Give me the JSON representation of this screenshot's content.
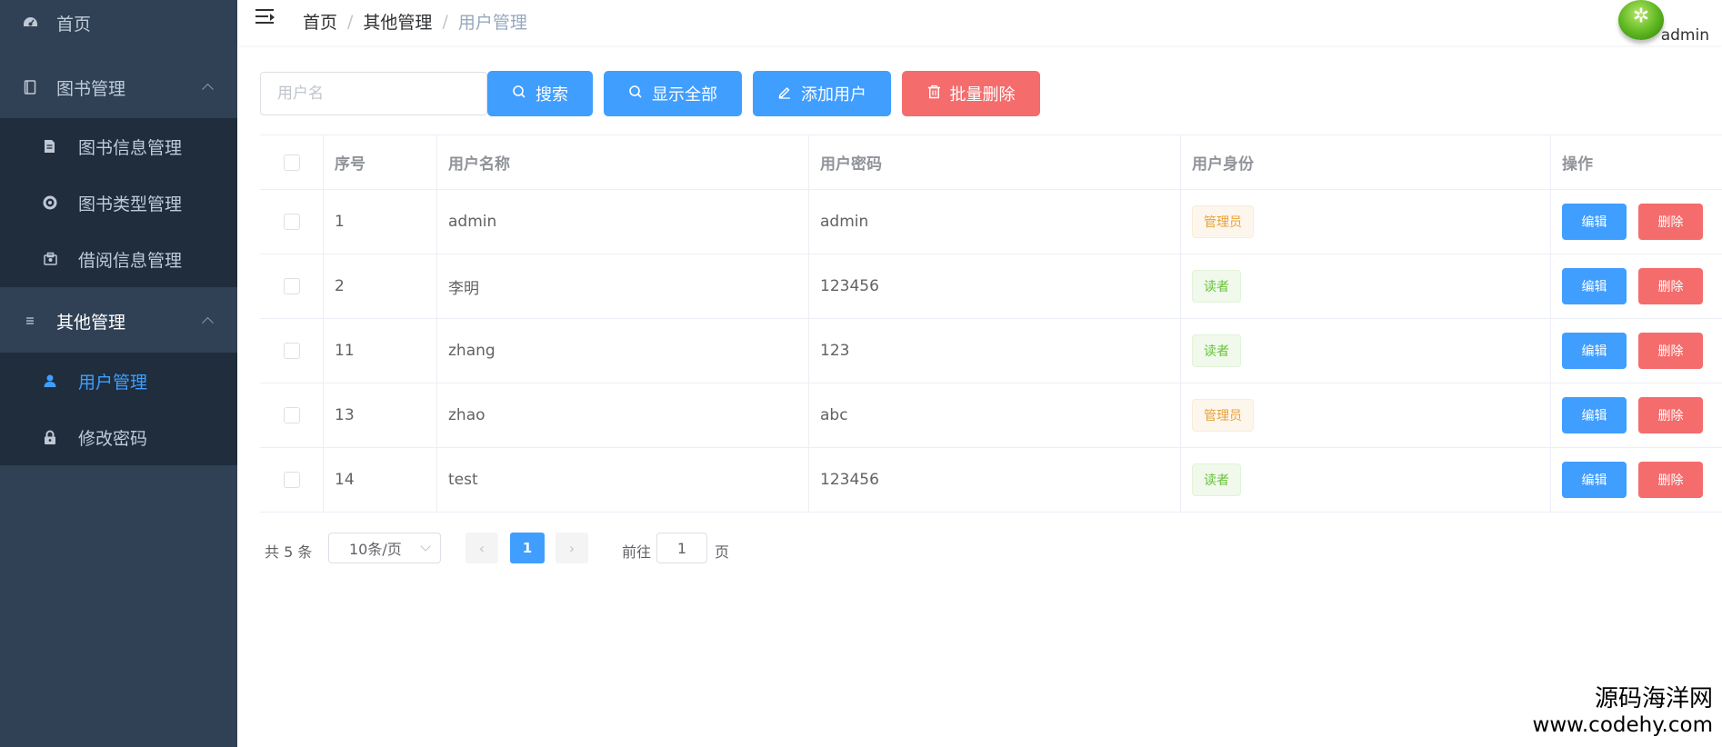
{
  "sidebar": {
    "items": [
      {
        "label": "首页",
        "icon": "dashboard-icon"
      },
      {
        "label": "图书管理",
        "icon": "book-icon",
        "expanded": true
      },
      {
        "label": "图书信息管理",
        "icon": "document-edit-icon"
      },
      {
        "label": "图书类型管理",
        "icon": "ring-icon"
      },
      {
        "label": "借阅信息管理",
        "icon": "borrow-icon"
      },
      {
        "label": "其他管理",
        "icon": "menu-lines-icon",
        "expanded": true
      },
      {
        "label": "用户管理",
        "icon": "user-icon",
        "active": true
      },
      {
        "label": "修改密码",
        "icon": "lock-icon"
      }
    ],
    "active_color": "#409eff"
  },
  "header": {
    "breadcrumb": [
      "首页",
      "其他管理",
      "用户管理"
    ],
    "breadcrumb_sep": "/",
    "username": "admin"
  },
  "toolbar": {
    "search_placeholder": "用户名",
    "search_label": "搜索",
    "show_all_label": "显示全部",
    "add_label": "添加用户",
    "batch_delete_label": "批量删除"
  },
  "table": {
    "columns": [
      "序号",
      "用户名称",
      "用户密码",
      "用户身份",
      "操作"
    ],
    "rows": [
      {
        "id": "1",
        "name": "admin",
        "password": "admin",
        "role": "管理员"
      },
      {
        "id": "2",
        "name": "李明",
        "password": "123456",
        "role": "读者"
      },
      {
        "id": "11",
        "name": "zhang",
        "password": "123",
        "role": "读者"
      },
      {
        "id": "13",
        "name": "zhao",
        "password": "abc",
        "role": "管理员"
      },
      {
        "id": "14",
        "name": "test",
        "password": "123456",
        "role": "读者"
      }
    ],
    "edit_label": "编辑",
    "delete_label": "删除"
  },
  "pagination": {
    "total": "共 5 条",
    "page_size": "10条/页",
    "prev": "‹",
    "next": "›",
    "current_page": "1",
    "goto_label": "前往",
    "goto_value": "1",
    "page_suffix": "页"
  },
  "watermark": {
    "line1": "源码海洋网",
    "line2": "www.codehy.com"
  },
  "colors": {
    "sidebar_bg": "#304156",
    "submenu_bg": "#1f2d3d",
    "primary": "#409eff",
    "danger": "#f56c6c",
    "tag_admin": "#e6a23c",
    "tag_reader": "#67c23a"
  }
}
